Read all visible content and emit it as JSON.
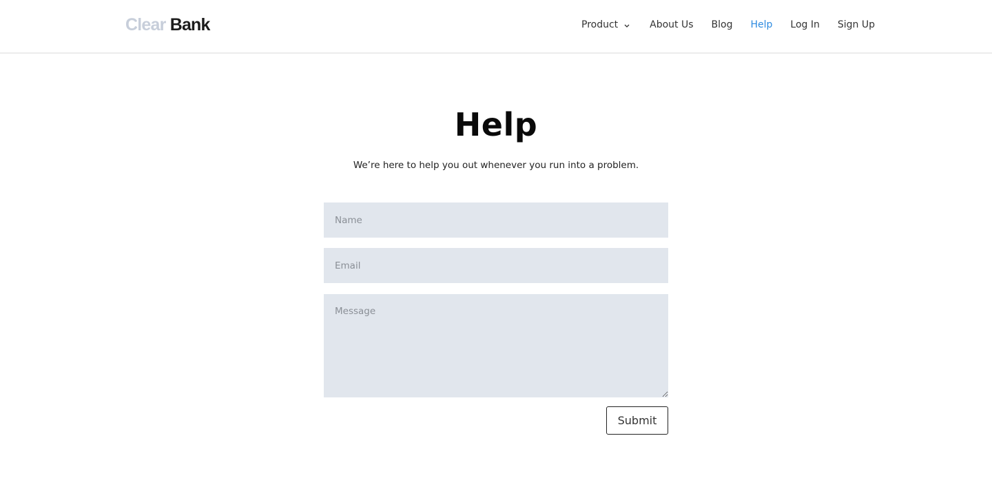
{
  "header": {
    "logo": {
      "part1": "Clear",
      "part2": "Bank"
    },
    "nav": [
      {
        "label": "Product",
        "has_dropdown": true,
        "active": false
      },
      {
        "label": "About Us",
        "active": false
      },
      {
        "label": "Blog",
        "active": false
      },
      {
        "label": "Help",
        "active": true
      },
      {
        "label": "Log In",
        "active": false
      },
      {
        "label": "Sign Up",
        "active": false
      }
    ],
    "active_color": "#2c8ae0"
  },
  "main": {
    "title": "Help",
    "subtitle": "We’re here to help you out whenever you run into a problem.",
    "form": {
      "name": {
        "placeholder": "Name",
        "value": ""
      },
      "email": {
        "placeholder": "Email",
        "value": ""
      },
      "message": {
        "placeholder": "Message",
        "value": ""
      },
      "submit_label": "Submit"
    }
  }
}
